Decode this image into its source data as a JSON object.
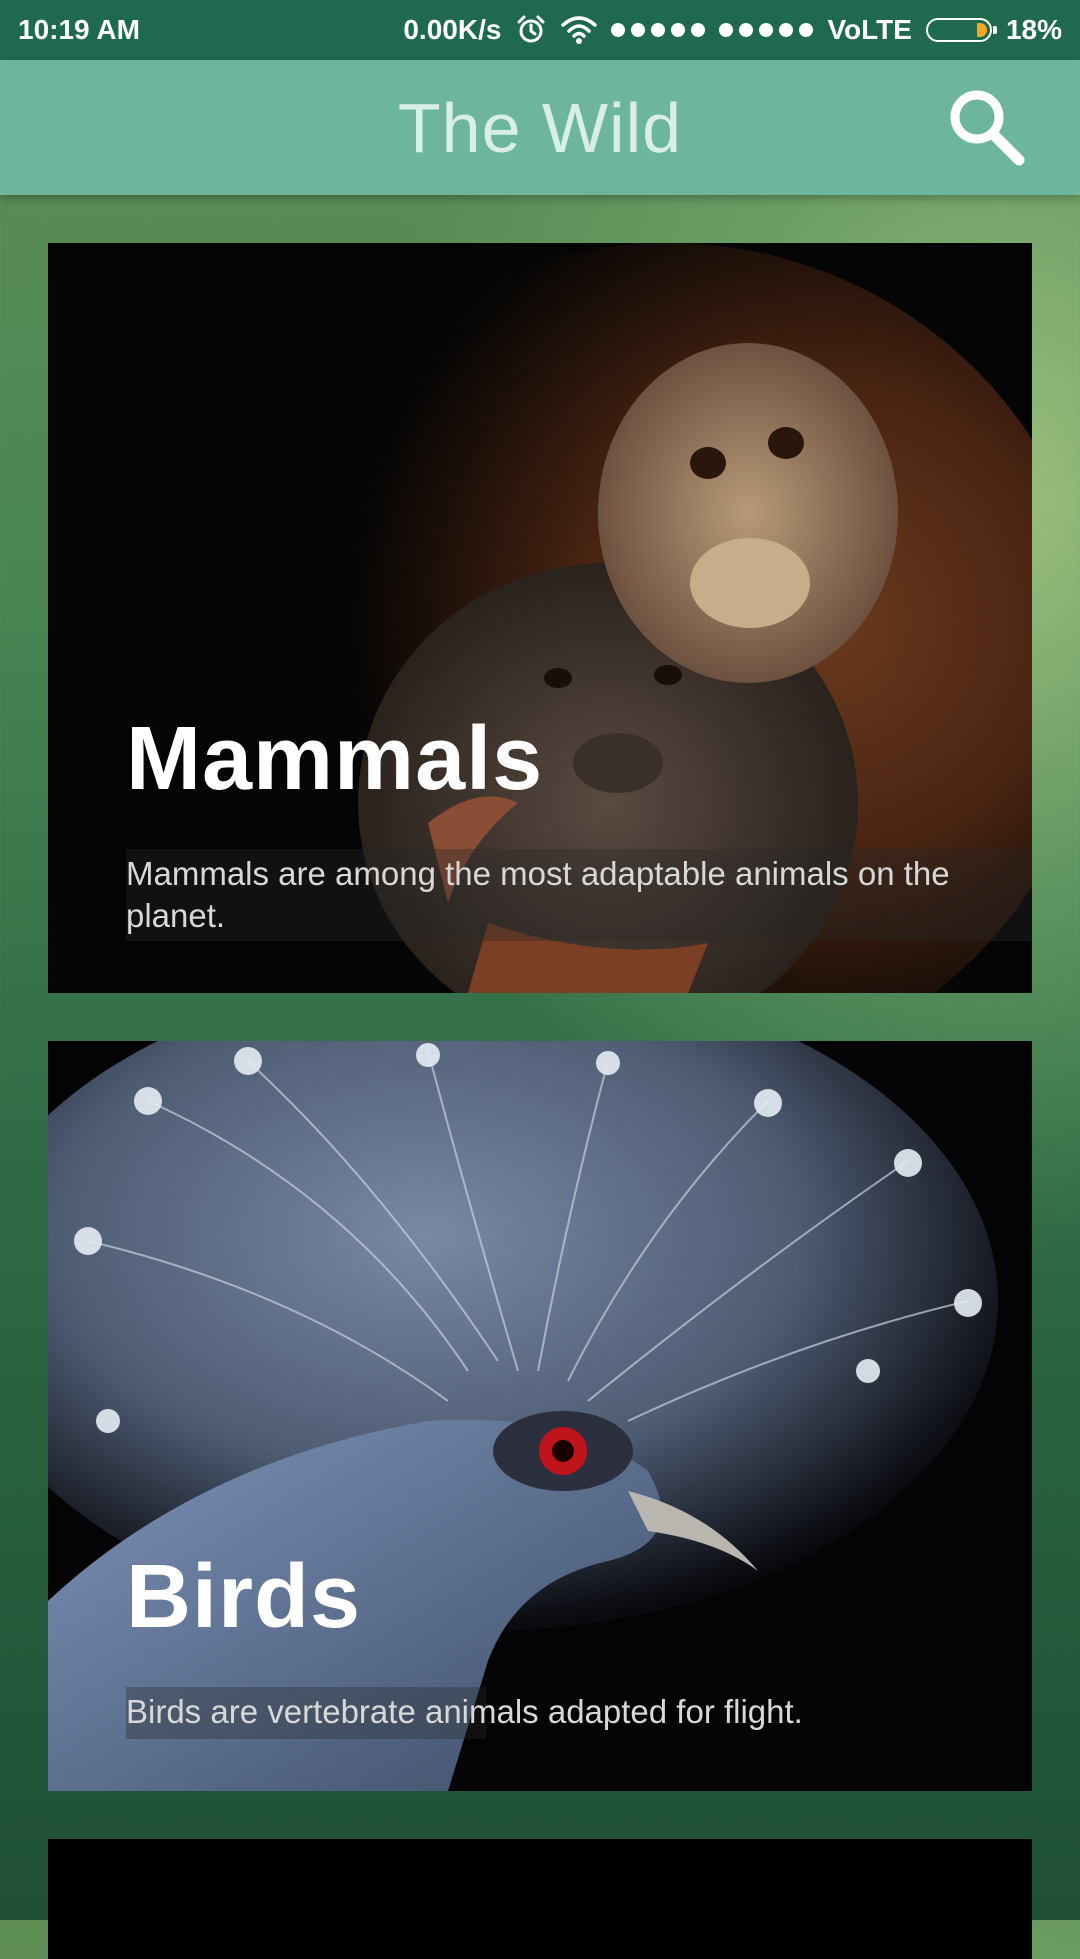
{
  "status_bar": {
    "time": "10:19 AM",
    "network_speed": "0.00K/s",
    "carrier": "VoLTE",
    "battery_percent": "18%",
    "battery_level": 0.18,
    "icons": [
      "alarm-icon",
      "wifi-icon",
      "signal-icon",
      "battery-icon"
    ]
  },
  "app_bar": {
    "title": "The Wild",
    "search_icon": "search-icon"
  },
  "cards": [
    {
      "title": "Mammals",
      "description": "Mammals are among the most adaptable animals on the planet."
    },
    {
      "title": "Birds",
      "description": "Birds are vertebrate animals adapted for flight."
    }
  ],
  "colors": {
    "status_bar": "#1f6a4e",
    "app_bar": "#6db59c",
    "title_text": "#d9efe6",
    "battery_fill": "#f5a623"
  }
}
